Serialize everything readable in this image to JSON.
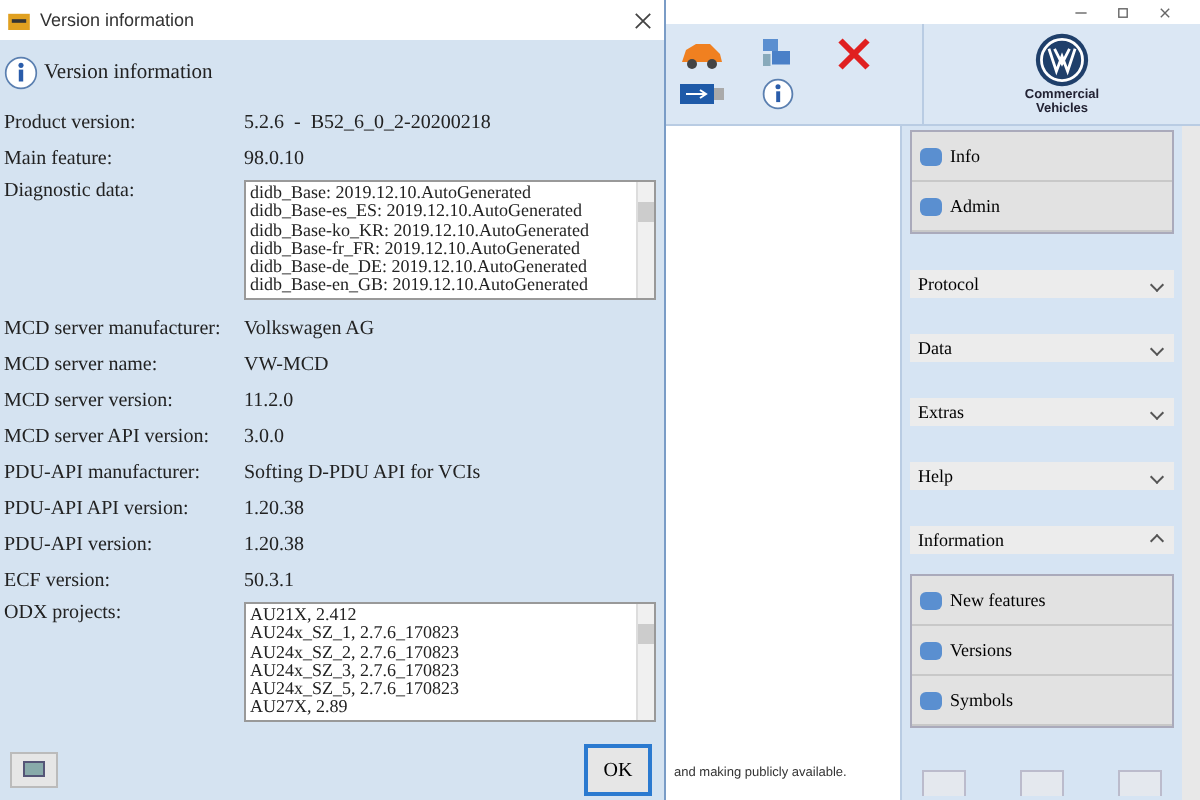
{
  "dialog": {
    "title": "Version information",
    "heading": "Version information",
    "fields": [
      {
        "kind": "text",
        "label": "Product version:",
        "value": "5.2.6  -  B52_6_0_2-20200218"
      },
      {
        "kind": "text",
        "label": "Main feature:",
        "value": "98.0.10"
      },
      {
        "kind": "list",
        "label": "Diagnostic data:",
        "items": [
          "didb_Base: 2019.12.10.AutoGenerated",
          "didb_Base-es_ES: 2019.12.10.AutoGenerated",
          "didb_Base-ko_KR: 2019.12.10.AutoGenerated",
          "didb_Base-fr_FR: 2019.12.10.AutoGenerated",
          "didb_Base-de_DE: 2019.12.10.AutoGenerated",
          "didb_Base-en_GB: 2019.12.10.AutoGenerated"
        ]
      },
      {
        "kind": "text",
        "label": "MCD server manufacturer:",
        "value": "Volkswagen AG"
      },
      {
        "kind": "text",
        "label": "MCD server name:",
        "value": "VW-MCD"
      },
      {
        "kind": "text",
        "label": "MCD server version:",
        "value": "11.2.0"
      },
      {
        "kind": "text",
        "label": "MCD server API version:",
        "value": "3.0.0"
      },
      {
        "kind": "text",
        "label": "PDU-API manufacturer:",
        "value": "Softing D-PDU API for VCIs"
      },
      {
        "kind": "text",
        "label": "PDU-API API version:",
        "value": "1.20.38"
      },
      {
        "kind": "text",
        "label": "PDU-API version:",
        "value": "1.20.38"
      },
      {
        "kind": "text",
        "label": "ECF version:",
        "value": "50.3.1"
      },
      {
        "kind": "list",
        "label": "ODX projects:",
        "items": [
          "AU21X, 2.412",
          "AU24x_SZ_1, 2.7.6_170823",
          "AU24x_SZ_2, 2.7.6_170823",
          "AU24x_SZ_3, 2.7.6_170823",
          "AU24x_SZ_5, 2.7.6_170823",
          "AU27X, 2.89"
        ]
      }
    ],
    "ok_button": "OK"
  },
  "app": {
    "logo_text": "Commercial Vehicles",
    "top_items": [
      "Info",
      "Admin"
    ],
    "sections": [
      {
        "title": "Protocol",
        "expanded": false
      },
      {
        "title": "Data",
        "expanded": false
      },
      {
        "title": "Extras",
        "expanded": false
      },
      {
        "title": "Help",
        "expanded": false
      },
      {
        "title": "Information",
        "expanded": true,
        "items": [
          "New features",
          "Versions",
          "Symbols"
        ]
      }
    ],
    "status_text": "and making publicly available."
  }
}
